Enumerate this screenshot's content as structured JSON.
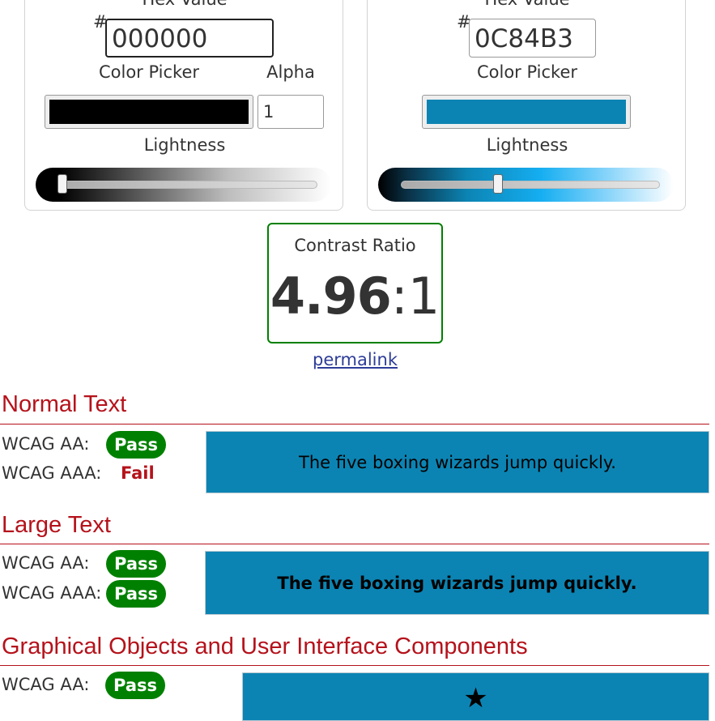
{
  "foreground": {
    "hex_label": "Hex Value",
    "hash": "#",
    "hex_value": "000000",
    "picker_label": "Color Picker",
    "color": "#000000",
    "alpha_label": "Alpha",
    "alpha_value": "1",
    "lightness_label": "Lightness",
    "lightness": 0.02
  },
  "background": {
    "hex_label": "Hex Value",
    "hash": "#",
    "hex_value": "0C84B3",
    "picker_label": "Color Picker",
    "color": "#0C84B3",
    "lightness_label": "Lightness",
    "lightness": 0.37
  },
  "contrast": {
    "label": "Contrast Ratio",
    "value": "4.96",
    "suffix": ":1",
    "permalink": "permalink"
  },
  "sections": {
    "normal": {
      "title": "Normal Text",
      "aa_label": "WCAG AA:",
      "aa_result": "Pass",
      "aaa_label": "WCAG AAA:",
      "aaa_result": "Fail",
      "sample_text": "The five boxing wizards jump quickly."
    },
    "large": {
      "title": "Large Text",
      "aa_label": "WCAG AA:",
      "aa_result": "Pass",
      "aaa_label": "WCAG AAA:",
      "aaa_result": "Pass",
      "sample_text": "The five boxing wizards jump quickly."
    },
    "graphical": {
      "title": "Graphical Objects and User Interface Components",
      "aa_label": "WCAG AA:",
      "aa_result": "Pass",
      "sample_icon": "star-icon"
    }
  },
  "colors": {
    "pass": "#008000",
    "fail": "#B5121B",
    "heading": "#B5121B",
    "link": "#2E3D98"
  }
}
